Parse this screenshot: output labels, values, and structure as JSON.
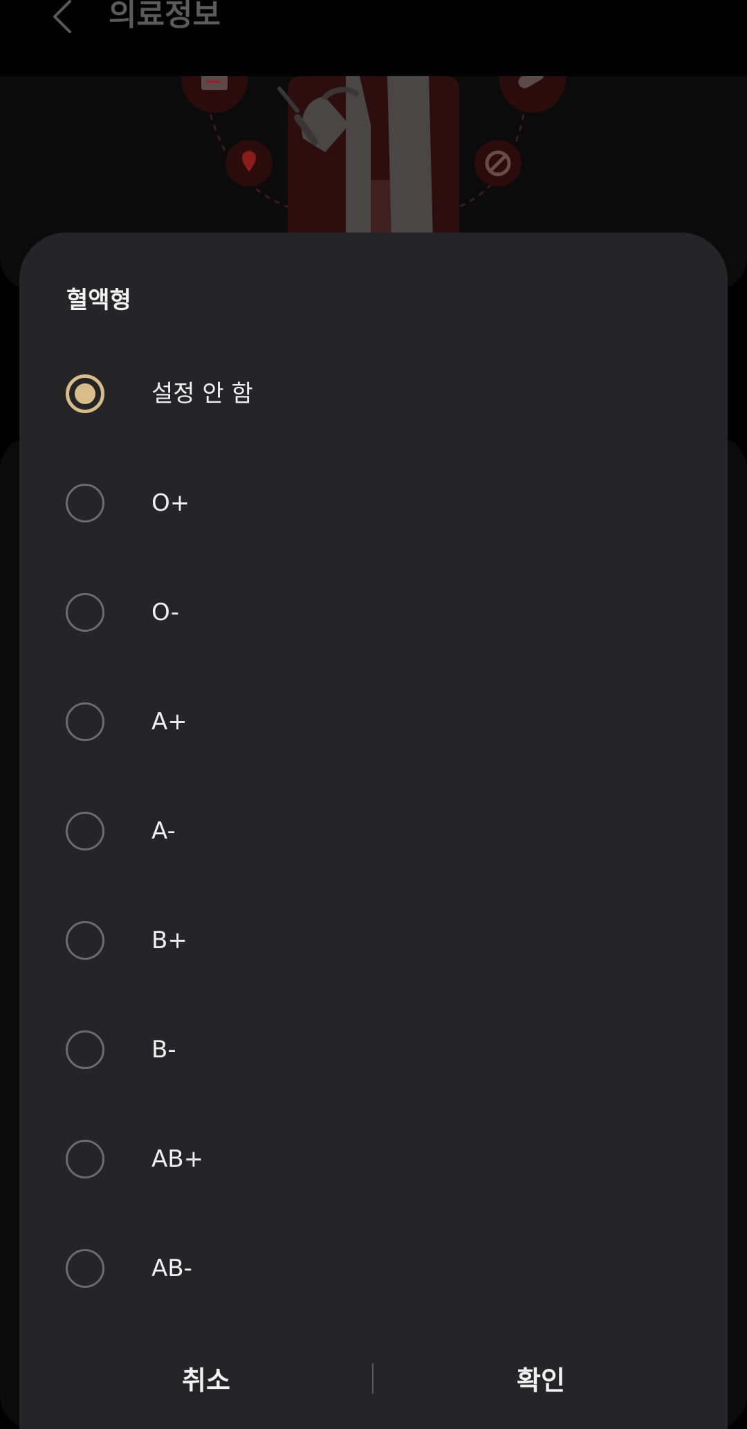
{
  "header": {
    "title": "의료정보",
    "back_icon": "chevron-left-icon"
  },
  "illustration": {
    "icons": [
      "calendar-icon",
      "location-pin-icon",
      "no-entry-icon",
      "pill-icon"
    ],
    "accent_color": "#3a1212"
  },
  "dialog": {
    "title": "혈액형",
    "options": [
      {
        "label": "설정 안 함",
        "selected": true
      },
      {
        "label": "O+",
        "selected": false
      },
      {
        "label": "O-",
        "selected": false
      },
      {
        "label": "A+",
        "selected": false
      },
      {
        "label": "A-",
        "selected": false
      },
      {
        "label": "B+",
        "selected": false
      },
      {
        "label": "B-",
        "selected": false
      },
      {
        "label": "AB+",
        "selected": false
      },
      {
        "label": "AB-",
        "selected": false
      }
    ],
    "cancel_label": "취소",
    "ok_label": "확인",
    "accent_color": "#d8bd8a"
  }
}
